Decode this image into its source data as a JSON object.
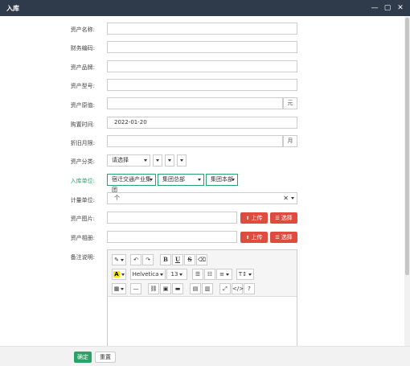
{
  "window": {
    "title": "入库",
    "minimize_glyph": "—",
    "maximize_glyph": "▢",
    "close_glyph": "✕"
  },
  "form": {
    "asset_name": {
      "label": "资产名称:",
      "value": ""
    },
    "finance_code": {
      "label": "财务编码:",
      "value": ""
    },
    "asset_brand": {
      "label": "资产品牌:",
      "value": ""
    },
    "asset_model": {
      "label": "资产型号:",
      "value": ""
    },
    "original_value": {
      "label": "资产原值:",
      "value": "",
      "unit": "元"
    },
    "purchase_date": {
      "label": "购置时间:",
      "value": "2022-01-20"
    },
    "depreciation_months": {
      "label": "折旧月限:",
      "value": "",
      "unit": "月"
    },
    "asset_category": {
      "label": "资产分类:",
      "value": "请选择"
    },
    "storage_unit": {
      "label": "入库单位:",
      "values": [
        "宿迁交通产业集团",
        "集团总部",
        "集团本部"
      ]
    },
    "measure_unit": {
      "label": "计量单位:",
      "value": "个",
      "clear_glyph": "✕"
    },
    "asset_image": {
      "label": "资产图片:",
      "upload": "上传",
      "choose": "选择"
    },
    "asset_attachment": {
      "label": "资产相册:",
      "upload": "上传",
      "choose": "选择"
    },
    "remarks": {
      "label": "备注说明:"
    }
  },
  "editor": {
    "magic": "✎",
    "undo": "↶",
    "redo": "↷",
    "bold": "B",
    "underline": "U",
    "strikethrough": "S",
    "eraser": "⌫",
    "color_a": "A",
    "font_name": "Helvetica",
    "font_size": "13",
    "ul": "☰",
    "ol": "☷",
    "align": "≡",
    "line_height": "T↕",
    "table": "▦",
    "hr": "—",
    "link": "⛓",
    "picture": "▣",
    "video": "▬",
    "doc1": "▤",
    "doc2": "▥",
    "fullscreen": "⤢",
    "code": "</>",
    "help": "?"
  },
  "footer": {
    "ok": "确定",
    "reset": "重置"
  },
  "colors": {
    "titlebar": "#2f3a4a",
    "green": "#2aa168",
    "red": "#e04b3f"
  }
}
